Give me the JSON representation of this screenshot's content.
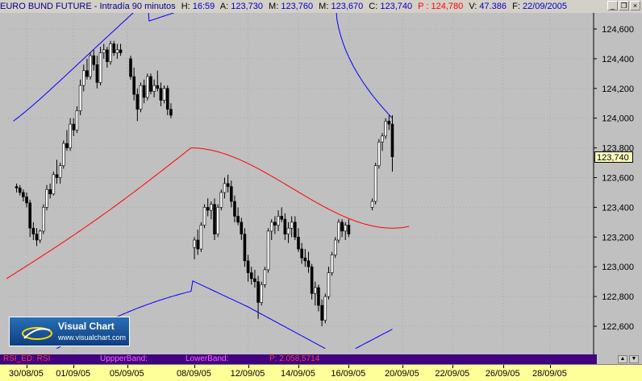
{
  "title": {
    "instrument": "EURO BUND FUTURE - Intradía 90 minutos",
    "h_label": "H:",
    "h_value": "16:59",
    "a_label": "A:",
    "a_value": "123,730",
    "m_label": "M:",
    "m_value": "123,760",
    "mn_label": "M:",
    "mn_value": "123,670",
    "c_label": "C:",
    "c_value": "123,740",
    "p_label": "P :",
    "p_value": "124,780",
    "v_label": "V:",
    "v_value": "47.386",
    "f_label": "F:",
    "f_value": "22/09/2005"
  },
  "window_buttons": {
    "minimize": "_",
    "restore": "❐",
    "close": "×"
  },
  "colors": {
    "background": "#c0c0c0",
    "candle": "#000000",
    "upper_band": "#0000ff",
    "lower_band": "#0000ff",
    "middle_band": "#ff0000",
    "grid": "#a8a8a8",
    "rsi_bar": "#400080"
  },
  "logo": {
    "brand": "Visual Chart",
    "url": "www.visualchart.com",
    "icon": "swoosh-icon"
  },
  "price_tag": "123,740",
  "rsi_bar": {
    "rsi_label": "RSI_ED: RSI",
    "upper_label": "UppperBand:",
    "lower_label": "LowerBand:",
    "p_label": "P: 2.058,5714"
  },
  "rsi_axis": {
    "up": "▲",
    "down": "▼"
  },
  "chart_data": {
    "type": "candlestick",
    "y_ticks": [
      "124,600",
      "124,400",
      "124,200",
      "124,000",
      "123,800",
      "123,600",
      "123,400",
      "123,200",
      "123,000",
      "122,800",
      "122,600"
    ],
    "ylim": [
      122450,
      124800
    ],
    "x_ticks": [
      "30/08/05",
      "01/09/05",
      "05/09/05",
      "08/09/05",
      "12/09/05",
      "14/09/05",
      "16/09/05",
      "20/09/05",
      "22/09/05",
      "26/09/05",
      "28/09/05"
    ],
    "x_tick_index": [
      6,
      20,
      36,
      56,
      72,
      87,
      102,
      118,
      133,
      148,
      162
    ],
    "grid": true,
    "n_bars": 175,
    "candles": [
      [
        3,
        123540,
        123560,
        123500,
        123530
      ],
      [
        4,
        123530,
        123550,
        123480,
        123500
      ],
      [
        5,
        123500,
        123520,
        123440,
        123470
      ],
      [
        6,
        123470,
        123500,
        123400,
        123430
      ],
      [
        7,
        123430,
        123450,
        123200,
        123260
      ],
      [
        8,
        123260,
        123300,
        123180,
        123220
      ],
      [
        9,
        123220,
        123260,
        123140,
        123180
      ],
      [
        10,
        123180,
        123250,
        123160,
        123240
      ],
      [
        11,
        123240,
        123420,
        123220,
        123400
      ],
      [
        12,
        123400,
        123550,
        123380,
        123520
      ],
      [
        13,
        123520,
        123560,
        123460,
        123490
      ],
      [
        14,
        123490,
        123640,
        123480,
        123620
      ],
      [
        15,
        123620,
        123720,
        123560,
        123600
      ],
      [
        16,
        123600,
        123700,
        123560,
        123680
      ],
      [
        17,
        123680,
        123850,
        123660,
        123830
      ],
      [
        18,
        123830,
        123920,
        123780,
        123800
      ],
      [
        19,
        123800,
        124000,
        123780,
        123960
      ],
      [
        20,
        123960,
        124000,
        123880,
        123920
      ],
      [
        21,
        123920,
        124080,
        123900,
        124050
      ],
      [
        22,
        124050,
        124260,
        124020,
        124220
      ],
      [
        23,
        124220,
        124360,
        124180,
        124320
      ],
      [
        24,
        124320,
        124400,
        124260,
        124280
      ],
      [
        25,
        124280,
        124440,
        124260,
        124420
      ],
      [
        26,
        124420,
        124460,
        124320,
        124360
      ],
      [
        27,
        124360,
        124420,
        124200,
        124240
      ],
      [
        28,
        124240,
        124480,
        124220,
        124440
      ],
      [
        29,
        124440,
        124500,
        124400,
        124460
      ],
      [
        30,
        124460,
        124480,
        124340,
        124380
      ],
      [
        31,
        124380,
        124520,
        124360,
        124500
      ],
      [
        32,
        124500,
        124520,
        124420,
        124440
      ],
      [
        33,
        124440,
        124500,
        124400,
        124460
      ],
      [
        34,
        124460,
        124500,
        124420,
        124440
      ],
      [
        37,
        124400,
        124420,
        124260,
        124280
      ],
      [
        38,
        124280,
        124340,
        124120,
        124160
      ],
      [
        39,
        124160,
        124200,
        123980,
        124060
      ],
      [
        40,
        124060,
        124240,
        124040,
        124220
      ],
      [
        41,
        124220,
        124260,
        124100,
        124140
      ],
      [
        42,
        124140,
        124300,
        124120,
        124280
      ],
      [
        43,
        124280,
        124300,
        124160,
        124180
      ],
      [
        44,
        124180,
        124260,
        124140,
        124220
      ],
      [
        45,
        124220,
        124320,
        124180,
        124200
      ],
      [
        46,
        124200,
        124240,
        124080,
        124120
      ],
      [
        47,
        124120,
        124220,
        124100,
        124200
      ],
      [
        48,
        124200,
        124220,
        124020,
        124060
      ],
      [
        49,
        124060,
        124100,
        124000,
        124020
      ],
      [
        56,
        123130,
        123200,
        123050,
        123180
      ],
      [
        57,
        123180,
        123250,
        123080,
        123120
      ],
      [
        58,
        123120,
        123300,
        123100,
        123280
      ],
      [
        59,
        123280,
        123420,
        123260,
        123400
      ],
      [
        60,
        123400,
        123460,
        123340,
        123380
      ],
      [
        61,
        123380,
        123440,
        123320,
        123420
      ],
      [
        62,
        123420,
        123460,
        123180,
        123220
      ],
      [
        63,
        123220,
        123420,
        123200,
        123400
      ],
      [
        64,
        123400,
        123520,
        123380,
        123500
      ],
      [
        65,
        123500,
        123600,
        123460,
        123560
      ],
      [
        66,
        123560,
        123620,
        123500,
        123540
      ],
      [
        67,
        123540,
        123580,
        123400,
        123440
      ],
      [
        68,
        123440,
        123480,
        123300,
        123340
      ],
      [
        69,
        123340,
        123400,
        123280,
        123300
      ],
      [
        70,
        123300,
        123330,
        123180,
        123220
      ],
      [
        71,
        123220,
        123260,
        123000,
        123040
      ],
      [
        72,
        123040,
        123080,
        122900,
        122960
      ],
      [
        73,
        122960,
        123000,
        122880,
        122920
      ],
      [
        74,
        122920,
        122980,
        122860,
        122900
      ],
      [
        75,
        122900,
        122940,
        122650,
        122760
      ],
      [
        76,
        122760,
        122900,
        122740,
        122880
      ],
      [
        77,
        122880,
        123000,
        122860,
        122980
      ],
      [
        78,
        122980,
        123260,
        122960,
        123240
      ],
      [
        79,
        123240,
        123320,
        123180,
        123300
      ],
      [
        80,
        123300,
        123340,
        123220,
        123280
      ],
      [
        81,
        123280,
        123380,
        123240,
        123340
      ],
      [
        82,
        123340,
        123400,
        123300,
        123320
      ],
      [
        83,
        123320,
        123360,
        123180,
        123220
      ],
      [
        84,
        123220,
        123300,
        123160,
        123260
      ],
      [
        85,
        123260,
        123340,
        123200,
        123300
      ],
      [
        86,
        123300,
        123340,
        123180,
        123200
      ],
      [
        87,
        123200,
        123260,
        123100,
        123120
      ],
      [
        88,
        123120,
        123160,
        123020,
        123060
      ],
      [
        89,
        123060,
        123120,
        123000,
        123040
      ],
      [
        90,
        123040,
        123100,
        122960,
        123000
      ],
      [
        91,
        123000,
        123020,
        122780,
        122820
      ],
      [
        92,
        122820,
        122900,
        122740,
        122860
      ],
      [
        93,
        122860,
        122880,
        122700,
        122740
      ],
      [
        94,
        122740,
        122780,
        122600,
        122640
      ],
      [
        95,
        122640,
        122820,
        122620,
        122800
      ],
      [
        96,
        122800,
        123000,
        122780,
        122960
      ],
      [
        97,
        122960,
        123100,
        122940,
        123080
      ],
      [
        98,
        123080,
        123200,
        123060,
        123180
      ],
      [
        99,
        123180,
        123320,
        123160,
        123300
      ],
      [
        100,
        123300,
        123320,
        123200,
        123240
      ],
      [
        101,
        123240,
        123300,
        123180,
        123280
      ],
      [
        102,
        123280,
        123320,
        123200,
        123220
      ],
      [
        109,
        123400,
        123460,
        123380,
        123440
      ],
      [
        110,
        123440,
        123700,
        123420,
        123680
      ],
      [
        111,
        123680,
        123860,
        123660,
        123840
      ],
      [
        112,
        123840,
        123900,
        123780,
        123880
      ],
      [
        113,
        123880,
        124000,
        123860,
        123980
      ],
      [
        114,
        123980,
        124020,
        123920,
        123960
      ],
      [
        115,
        123960,
        124020,
        123640,
        123740
      ]
    ],
    "upper_band_end": 124000,
    "middle_band_end": 123260,
    "lower_band_end": 122580
  }
}
